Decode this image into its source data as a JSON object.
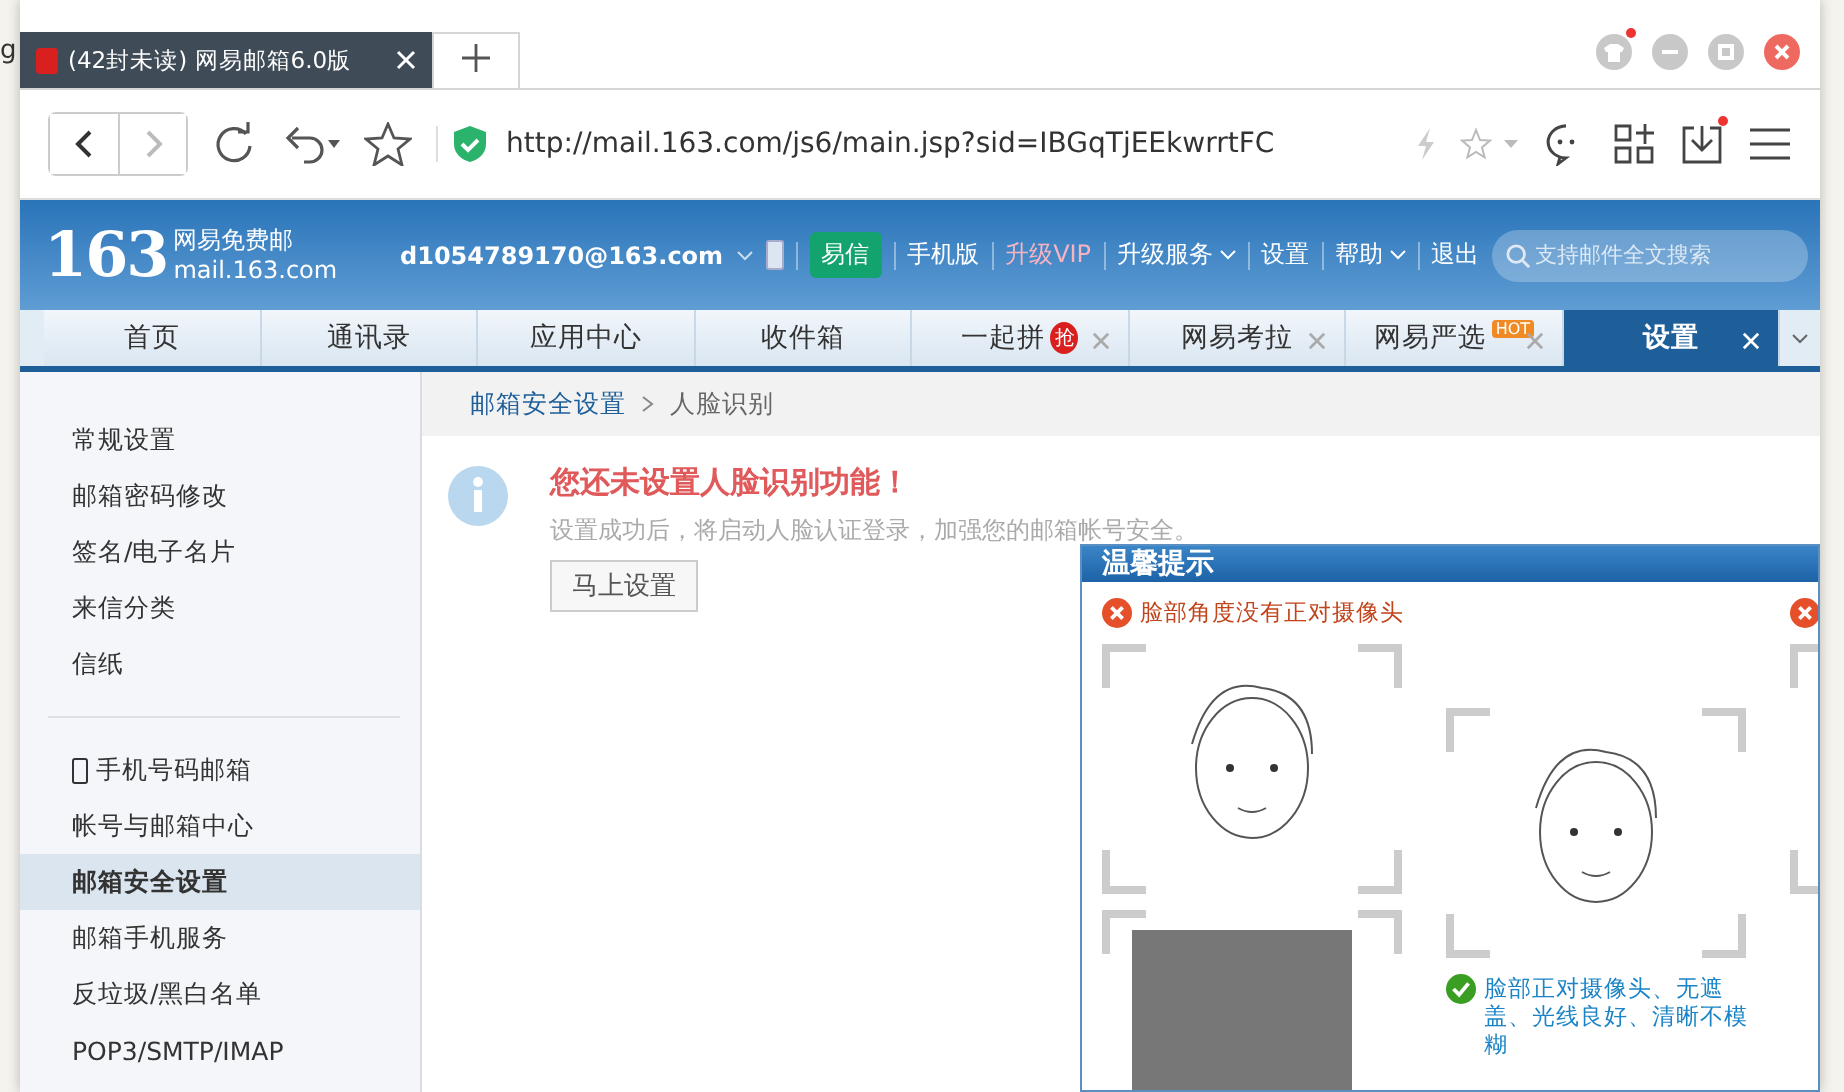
{
  "edge_text": "g",
  "browser": {
    "tab_title": "(42封未读) 网易邮箱6.0版",
    "url": "http://mail.163.com/js6/main.jsp?sid=IBGqTjEEkwrrtFC"
  },
  "mail_header": {
    "logo_number": "163",
    "logo_name": "网易免费邮",
    "logo_domain": "mail.163.com",
    "account": "d1054789170@163.com",
    "yixin": "易信",
    "links": [
      {
        "label": "手机版",
        "kind": "plain"
      },
      {
        "label": "升级VIP",
        "kind": "vip"
      },
      {
        "label": "升级服务",
        "kind": "menu"
      },
      {
        "label": "设置",
        "kind": "plain"
      },
      {
        "label": "帮助",
        "kind": "menu"
      },
      {
        "label": "退出",
        "kind": "plain"
      }
    ],
    "search": {
      "placeholder": "支持邮件全文搜索"
    }
  },
  "nav_tabs": [
    {
      "label": "首页",
      "selected": false,
      "closable": false
    },
    {
      "label": "通讯录",
      "selected": false,
      "closable": false
    },
    {
      "label": "应用中心",
      "selected": false,
      "closable": false
    },
    {
      "label": "收件箱",
      "selected": false,
      "closable": false
    },
    {
      "label": "一起拼",
      "selected": false,
      "closable": true,
      "badge": "抢"
    },
    {
      "label": "网易考拉",
      "selected": false,
      "closable": true
    },
    {
      "label": "网易严选",
      "selected": false,
      "closable": true,
      "badge": "HOT"
    },
    {
      "label": "设置",
      "selected": true,
      "closable": true
    }
  ],
  "sidebar": {
    "groups": [
      [
        {
          "label": "常规设置",
          "selected": false
        },
        {
          "label": "邮箱密码修改",
          "selected": false
        },
        {
          "label": "签名/电子名片",
          "selected": false
        },
        {
          "label": "来信分类",
          "selected": false
        },
        {
          "label": "信纸",
          "selected": false
        }
      ],
      [
        {
          "label": "手机号码邮箱",
          "selected": false,
          "phone": true
        },
        {
          "label": "帐号与邮箱中心",
          "selected": false
        },
        {
          "label": "邮箱安全设置",
          "selected": true
        },
        {
          "label": "邮箱手机服务",
          "selected": false
        },
        {
          "label": "反垃圾/黑白名单",
          "selected": false
        },
        {
          "label": "POP3/SMTP/IMAP",
          "selected": false
        }
      ]
    ]
  },
  "breadcrumb": [
    "邮箱安全设置",
    "人脸识别"
  ],
  "notice": {
    "title": "您还未设置人脸识别功能！",
    "text": "设置成功后，将启动人脸认证登录，加强您的邮箱帐号安全。",
    "button": "马上设置"
  },
  "dialog": {
    "title": "温馨提示",
    "tips": [
      {
        "kind": "bad",
        "text": "脸部角度没有正对摄像头"
      },
      {
        "kind": "good",
        "text": "脸部正对摄像头、无遮盖、光线良好、清晰不模糊"
      }
    ]
  }
}
